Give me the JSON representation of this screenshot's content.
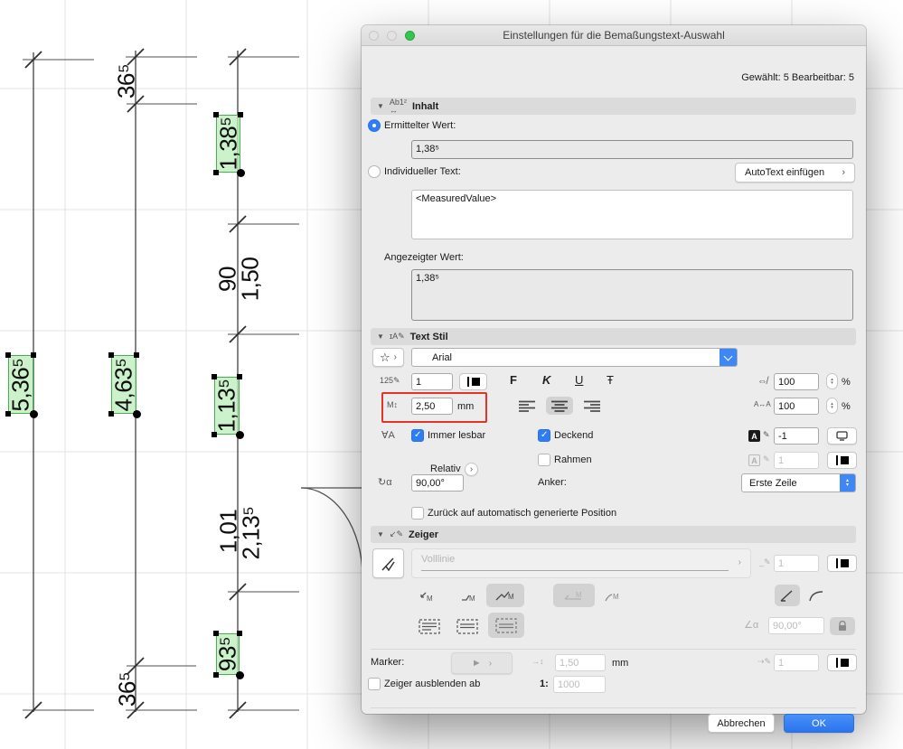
{
  "window": {
    "title": "Einstellungen für die Bemaßungstext-Auswahl",
    "status": "Gewählt: 5 Bearbeitbar: 5"
  },
  "inhalt": {
    "header": "Inhalt",
    "ermittelter_label": "Ermittelter Wert:",
    "ermittelter_value": "1,38⁵",
    "individueller_label": "Individueller Text:",
    "autotext_button": "AutoText einfügen",
    "custom_text": "<MeasuredValue>",
    "angezeigter_label": "Angezeigter Wert:",
    "angezeigter_value": "1,38⁵"
  },
  "textstil": {
    "header": "Text Stil",
    "font_name": "Arial",
    "pen_value": "1",
    "size_value": "2,50",
    "size_unit": "mm",
    "bold": "F",
    "italic": "K",
    "underline": "U",
    "strike": "Ŧ",
    "width_value": "100",
    "width_unit": "%",
    "spacing_value": "100",
    "spacing_unit": "%",
    "immer_lesbar": "Immer lesbar",
    "deckend": "Deckend",
    "rahmen": "Rahmen",
    "relativ": "Relativ",
    "angle_value": "90,00°",
    "anker_label": "Anker:",
    "anker_value": "Erste Zeile",
    "bg_pen_value": "-1",
    "frame_pen_value": "1",
    "reset_label": "Zurück auf automatisch generierte Position"
  },
  "zeiger": {
    "header": "Zeiger",
    "linetype": "Volllinie",
    "pen_value": "1",
    "angle_value": "90,00°",
    "marker_label": "Marker:",
    "offset_value": "1,50",
    "offset_unit": "mm",
    "marker_pen_value": "1",
    "hide_label": "Zeiger ausblenden ab",
    "scale_prefix": "1:",
    "scale_value": "1000"
  },
  "footer": {
    "cancel": "Abbrechen",
    "ok": "OK"
  },
  "colors": {
    "accent": "#2f7df5",
    "ok_button": "#2e7ef7",
    "highlight_red": "#e5332a",
    "selection_green": "#bdeebd"
  },
  "drawing": {
    "labels": [
      {
        "text": "36⁵"
      },
      {
        "text": "1,38⁵"
      },
      {
        "text": "90"
      },
      {
        "text": "1,50"
      },
      {
        "text": "5,36⁵"
      },
      {
        "text": "4,63⁵"
      },
      {
        "text": "1,13⁵"
      },
      {
        "text": "1,01"
      },
      {
        "text": "2,13⁵"
      },
      {
        "text": "93⁵"
      },
      {
        "text": "36⁵"
      }
    ]
  }
}
